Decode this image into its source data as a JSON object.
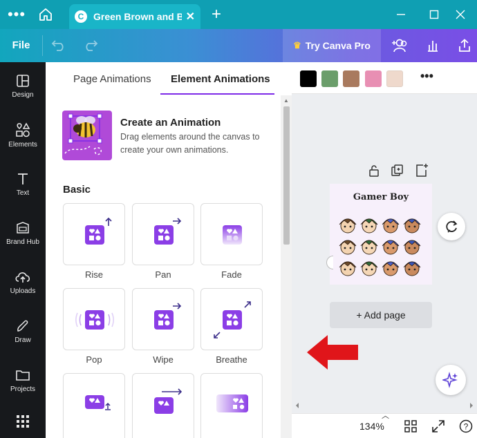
{
  "window": {
    "tab_title": "Green Brown and B...",
    "tab_logo": "C",
    "tab_close": "✕",
    "new_tab": "+",
    "menu_dots": "•••"
  },
  "toolbar": {
    "file_label": "File",
    "try_pro_label": "Try Canva Pro"
  },
  "sidebar": {
    "items": [
      {
        "label": "Design",
        "icon": "design-icon"
      },
      {
        "label": "Elements",
        "icon": "elements-icon"
      },
      {
        "label": "Text",
        "icon": "text-icon"
      },
      {
        "label": "Brand Hub",
        "icon": "brand-hub-icon"
      },
      {
        "label": "Uploads",
        "icon": "uploads-icon"
      },
      {
        "label": "Draw",
        "icon": "draw-icon"
      },
      {
        "label": "Projects",
        "icon": "projects-icon"
      },
      {
        "label": "",
        "icon": "apps-icon"
      }
    ]
  },
  "panel": {
    "tabs": [
      {
        "label": "Page Animations",
        "active": false
      },
      {
        "label": "Element Animations",
        "active": true
      }
    ],
    "create": {
      "title": "Create an Animation",
      "description": "Drag elements around the canvas to create your own animations."
    },
    "section_title": "Basic",
    "animations": [
      {
        "label": "Rise"
      },
      {
        "label": "Pan"
      },
      {
        "label": "Fade"
      },
      {
        "label": "Pop"
      },
      {
        "label": "Wipe"
      },
      {
        "label": "Breathe"
      },
      {
        "label": ""
      },
      {
        "label": ""
      },
      {
        "label": ""
      }
    ]
  },
  "canvas": {
    "swatches": [
      "#000000",
      "#6b9e6b",
      "#a97a5e",
      "#e88fb3",
      "#efd9cc"
    ],
    "more_label": "•••",
    "page_title": "Gamer Boy",
    "add_page_label": "+ Add page",
    "zoom": "134%"
  },
  "colors": {
    "accent": "#7d2ae8",
    "annotation_arrow": "#e0151a"
  }
}
